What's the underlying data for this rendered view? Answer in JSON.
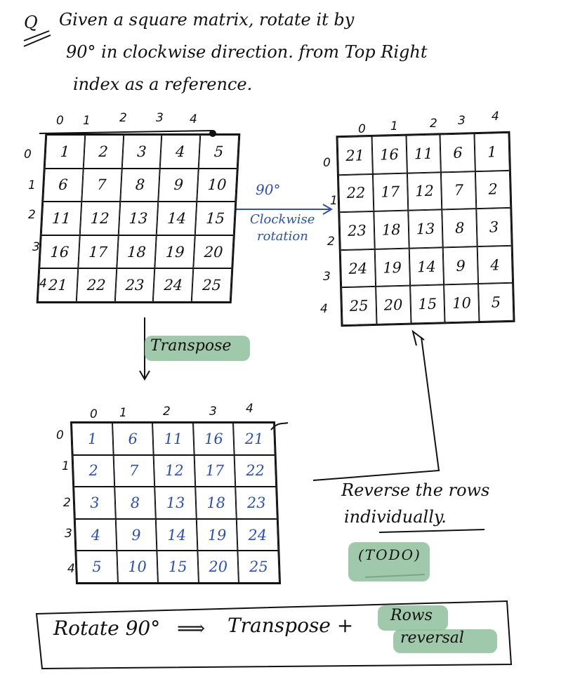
{
  "question": {
    "marker": "Q",
    "line1": "Given a square matrix, rotate it by",
    "line2": "90° in clockwise direction. from Top Right",
    "line3": "index as a reference."
  },
  "matrix_a": {
    "col_indices": [
      "0",
      "1",
      "2",
      "3",
      "4"
    ],
    "row_indices": [
      "0",
      "1",
      "2",
      "3",
      "4"
    ],
    "rows": [
      [
        "1",
        "2",
        "3",
        "4",
        "5"
      ],
      [
        "6",
        "7",
        "8",
        "9",
        "10"
      ],
      [
        "11",
        "12",
        "13",
        "14",
        "15"
      ],
      [
        "16",
        "17",
        "18",
        "19",
        "20"
      ],
      [
        "21",
        "22",
        "23",
        "24",
        "25"
      ]
    ]
  },
  "rotation_label": {
    "line1": "90°",
    "line2": "Clockwise",
    "line3": "rotation"
  },
  "matrix_b": {
    "col_indices": [
      "0",
      "1",
      "2",
      "3",
      "4"
    ],
    "row_indices": [
      "0",
      "1",
      "2",
      "3",
      "4"
    ],
    "rows": [
      [
        "21",
        "16",
        "11",
        "6",
        "1"
      ],
      [
        "22",
        "17",
        "12",
        "7",
        "2"
      ],
      [
        "23",
        "18",
        "13",
        "8",
        "3"
      ],
      [
        "24",
        "19",
        "14",
        "9",
        "4"
      ],
      [
        "25",
        "20",
        "15",
        "10",
        "5"
      ]
    ]
  },
  "transpose_label": "Transpose",
  "matrix_t": {
    "col_indices": [
      "0",
      "1",
      "2",
      "3",
      "4"
    ],
    "row_indices": [
      "0",
      "1",
      "2",
      "3",
      "4"
    ],
    "rows": [
      [
        "1",
        "6",
        "11",
        "16",
        "21"
      ],
      [
        "2",
        "7",
        "12",
        "17",
        "22"
      ],
      [
        "3",
        "8",
        "13",
        "18",
        "23"
      ],
      [
        "4",
        "9",
        "14",
        "19",
        "24"
      ],
      [
        "5",
        "10",
        "15",
        "20",
        "25"
      ]
    ]
  },
  "reverse_note": {
    "line1": "Reverse the rows",
    "line2": "individually."
  },
  "todo": "(TODO)",
  "summary": {
    "left": "Rotate 90°",
    "arrow": "⟹",
    "middle": "Transpose +",
    "hl1": "Rows",
    "hl2": "reversal"
  },
  "colors": {
    "ink": "#111111",
    "blue_ink": "#2a4fb5",
    "highlight": "#8fbf9c"
  }
}
